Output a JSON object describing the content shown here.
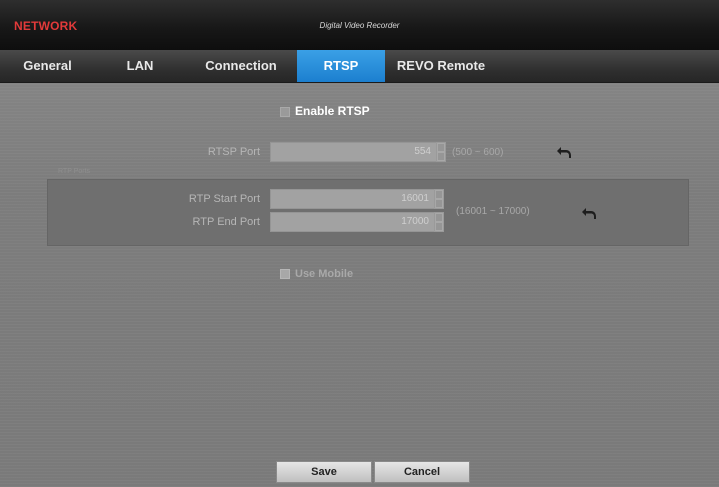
{
  "app": {
    "label": "NETWORK",
    "window_title": "Digital Video Recorder",
    "accent_color": "#e23a3a",
    "active_tab_color": "#2a8fdb"
  },
  "tabs": [
    {
      "label": "General",
      "active": false
    },
    {
      "label": "LAN",
      "active": false
    },
    {
      "label": "Connection",
      "active": false
    },
    {
      "label": "RTSP",
      "active": true
    },
    {
      "label": "REVO Remote",
      "active": false
    }
  ],
  "rtsp": {
    "enable_label": "Enable RTSP",
    "enabled": false,
    "port_label": "RTSP Port",
    "port_value": "554",
    "port_range": "(500 ~ 600)"
  },
  "rtp": {
    "group_caption": "RTP Ports",
    "start_label": "RTP Start Port",
    "start_value": "16001",
    "end_label": "RTP End Port",
    "end_value": "17000",
    "range": "(16001 ~ 17000)"
  },
  "mobile": {
    "label": "Use Mobile",
    "checked": false
  },
  "icons": {
    "undo": "undo-arrow-icon",
    "spin": "spinner-arrows-icon"
  },
  "buttons": {
    "save": "Save",
    "cancel": "Cancel"
  }
}
